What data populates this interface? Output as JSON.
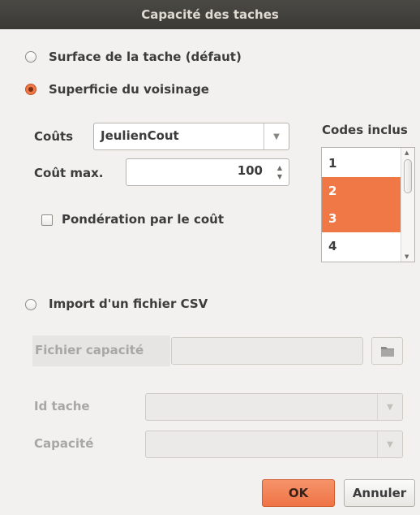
{
  "window": {
    "title": "Capacité des taches"
  },
  "options": {
    "surface": {
      "label": "Surface de la tache (défaut)",
      "checked": false
    },
    "superficie": {
      "label": "Superficie du voisinage",
      "checked": true
    },
    "csv": {
      "label": "Import d'un fichier CSV",
      "checked": false
    }
  },
  "voisinage": {
    "couts_label": "Coûts",
    "couts_value": "JeulienCout",
    "cout_max_label": "Coût max.",
    "cout_max_value": "100",
    "ponderation_label": "Pondération par le coût",
    "ponderation_checked": false
  },
  "codes": {
    "header": "Codes inclus",
    "items": [
      {
        "label": "1",
        "selected": false
      },
      {
        "label": "2",
        "selected": true
      },
      {
        "label": "3",
        "selected": true
      },
      {
        "label": "4",
        "selected": false
      }
    ]
  },
  "csv_section": {
    "fichier_label": "Fichier capacité",
    "fichier_value": "",
    "id_tache_label": "Id tache",
    "id_tache_value": "",
    "capacite_label": "Capacité",
    "capacite_value": ""
  },
  "buttons": {
    "ok": "OK",
    "cancel": "Annuler"
  },
  "colors": {
    "accent": "#f07746",
    "titlebar": "#3c3b37"
  }
}
